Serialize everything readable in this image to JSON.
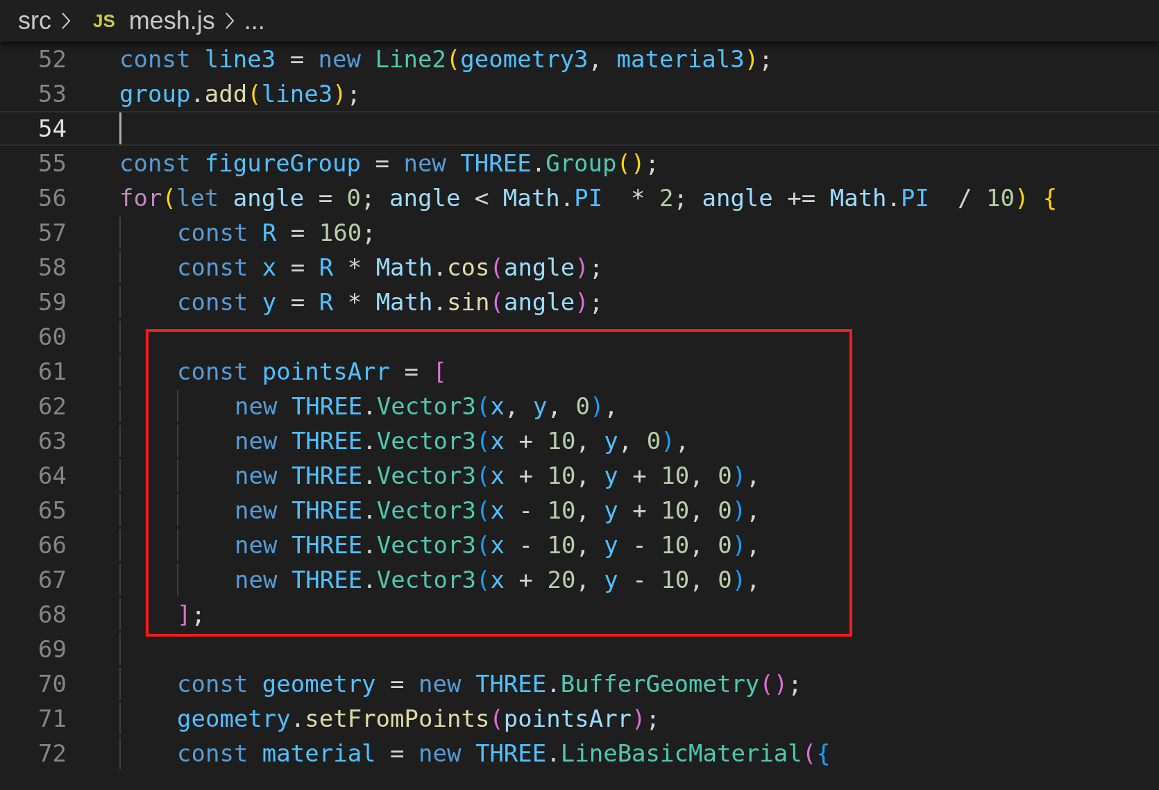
{
  "breadcrumbs": {
    "folder": "src",
    "file_badge": "JS",
    "file": "mesh.js",
    "tail": "..."
  },
  "lines": [
    {
      "kind": "line",
      "number": "52",
      "current": false,
      "tokens": [
        {
          "kind": "keyword",
          "text": "const "
        },
        {
          "kind": "constant",
          "text": "line3"
        },
        {
          "kind": "punct",
          "text": " = "
        },
        {
          "kind": "keyword",
          "text": "new "
        },
        {
          "kind": "class",
          "text": "Line2"
        },
        {
          "kind": "bracket1",
          "text": "("
        },
        {
          "kind": "constant",
          "text": "geometry3"
        },
        {
          "kind": "punct",
          "text": ", "
        },
        {
          "kind": "constant",
          "text": "material3"
        },
        {
          "kind": "bracket1",
          "text": ")"
        },
        {
          "kind": "punct",
          "text": ";"
        }
      ]
    },
    {
      "kind": "line",
      "number": "53",
      "current": false,
      "tokens": [
        {
          "kind": "constant",
          "text": "group"
        },
        {
          "kind": "punct",
          "text": "."
        },
        {
          "kind": "function",
          "text": "add"
        },
        {
          "kind": "bracket1",
          "text": "("
        },
        {
          "kind": "constant",
          "text": "line3"
        },
        {
          "kind": "bracket1",
          "text": ")"
        },
        {
          "kind": "punct",
          "text": ";"
        }
      ]
    },
    {
      "kind": "line",
      "number": "54",
      "current": true
    },
    {
      "kind": "line",
      "number": "55",
      "current": false,
      "tokens": [
        {
          "kind": "keyword",
          "text": "const "
        },
        {
          "kind": "constant",
          "text": "figureGroup"
        },
        {
          "kind": "punct",
          "text": " = "
        },
        {
          "kind": "keyword",
          "text": "new "
        },
        {
          "kind": "constant",
          "text": "THREE"
        },
        {
          "kind": "punct",
          "text": "."
        },
        {
          "kind": "class",
          "text": "Group"
        },
        {
          "kind": "bracket1",
          "text": "()"
        },
        {
          "kind": "punct",
          "text": ";"
        }
      ]
    },
    {
      "kind": "line",
      "number": "56",
      "current": false,
      "tokens": [
        {
          "kind": "control",
          "text": "for"
        },
        {
          "kind": "bracket1",
          "text": "("
        },
        {
          "kind": "keyword",
          "text": "let "
        },
        {
          "kind": "variable",
          "text": "angle"
        },
        {
          "kind": "punct",
          "text": " = "
        },
        {
          "kind": "number",
          "text": "0"
        },
        {
          "kind": "punct",
          "text": "; "
        },
        {
          "kind": "variable",
          "text": "angle"
        },
        {
          "kind": "punct",
          "text": " < "
        },
        {
          "kind": "variable",
          "text": "Math"
        },
        {
          "kind": "punct",
          "text": "."
        },
        {
          "kind": "constant",
          "text": "PI"
        },
        {
          "kind": "punct",
          "text": "  * "
        },
        {
          "kind": "number",
          "text": "2"
        },
        {
          "kind": "punct",
          "text": "; "
        },
        {
          "kind": "variable",
          "text": "angle"
        },
        {
          "kind": "punct",
          "text": " += "
        },
        {
          "kind": "variable",
          "text": "Math"
        },
        {
          "kind": "punct",
          "text": "."
        },
        {
          "kind": "constant",
          "text": "PI"
        },
        {
          "kind": "punct",
          "text": "  / "
        },
        {
          "kind": "number",
          "text": "10"
        },
        {
          "kind": "bracket1",
          "text": ") {"
        }
      ],
      "children": [
        {
          "kind": "line",
          "number": "57",
          "current": false,
          "tokens": [
            {
              "kind": "keyword",
              "text": "const "
            },
            {
              "kind": "constant",
              "text": "R"
            },
            {
              "kind": "punct",
              "text": " = "
            },
            {
              "kind": "number",
              "text": "160"
            },
            {
              "kind": "punct",
              "text": ";"
            }
          ]
        },
        {
          "kind": "line",
          "number": "58",
          "current": false,
          "tokens": [
            {
              "kind": "keyword",
              "text": "const "
            },
            {
              "kind": "constant",
              "text": "x"
            },
            {
              "kind": "punct",
              "text": " = "
            },
            {
              "kind": "constant",
              "text": "R"
            },
            {
              "kind": "punct",
              "text": " * "
            },
            {
              "kind": "variable",
              "text": "Math"
            },
            {
              "kind": "punct",
              "text": "."
            },
            {
              "kind": "function",
              "text": "cos"
            },
            {
              "kind": "bracket2",
              "text": "("
            },
            {
              "kind": "variable",
              "text": "angle"
            },
            {
              "kind": "bracket2",
              "text": ")"
            },
            {
              "kind": "punct",
              "text": ";"
            }
          ]
        },
        {
          "kind": "line",
          "number": "59",
          "current": false,
          "tokens": [
            {
              "kind": "keyword",
              "text": "const "
            },
            {
              "kind": "constant",
              "text": "y"
            },
            {
              "kind": "punct",
              "text": " = "
            },
            {
              "kind": "constant",
              "text": "R"
            },
            {
              "kind": "punct",
              "text": " * "
            },
            {
              "kind": "variable",
              "text": "Math"
            },
            {
              "kind": "punct",
              "text": "."
            },
            {
              "kind": "function",
              "text": "sin"
            },
            {
              "kind": "bracket2",
              "text": "("
            },
            {
              "kind": "variable",
              "text": "angle"
            },
            {
              "kind": "bracket2",
              "text": ")"
            },
            {
              "kind": "punct",
              "text": ";"
            }
          ]
        },
        {
          "kind": "boxed",
          "lines": [
            {
              "kind": "line",
              "number": "60",
              "current": false
            },
            {
              "kind": "line",
              "number": "61",
              "current": false,
              "tokens": [
                {
                  "kind": "keyword",
                  "text": "const "
                },
                {
                  "kind": "constant",
                  "text": "pointsArr"
                },
                {
                  "kind": "punct",
                  "text": " = "
                },
                {
                  "kind": "bracket2",
                  "text": "["
                }
              ],
              "children": [
                {
                  "kind": "line",
                  "number": "62",
                  "current": false,
                  "tokens": [
                    {
                      "kind": "keyword",
                      "text": "new "
                    },
                    {
                      "kind": "constant",
                      "text": "THREE"
                    },
                    {
                      "kind": "punct",
                      "text": "."
                    },
                    {
                      "kind": "class",
                      "text": "Vector3"
                    },
                    {
                      "kind": "bracket3",
                      "text": "("
                    },
                    {
                      "kind": "constant",
                      "text": "x"
                    },
                    {
                      "kind": "punct",
                      "text": ", "
                    },
                    {
                      "kind": "constant",
                      "text": "y"
                    },
                    {
                      "kind": "punct",
                      "text": ", "
                    },
                    {
                      "kind": "number",
                      "text": "0"
                    },
                    {
                      "kind": "bracket3",
                      "text": ")"
                    },
                    {
                      "kind": "punct",
                      "text": ","
                    }
                  ]
                },
                {
                  "kind": "line",
                  "number": "63",
                  "current": false,
                  "tokens": [
                    {
                      "kind": "keyword",
                      "text": "new "
                    },
                    {
                      "kind": "constant",
                      "text": "THREE"
                    },
                    {
                      "kind": "punct",
                      "text": "."
                    },
                    {
                      "kind": "class",
                      "text": "Vector3"
                    },
                    {
                      "kind": "bracket3",
                      "text": "("
                    },
                    {
                      "kind": "constant",
                      "text": "x"
                    },
                    {
                      "kind": "punct",
                      "text": " + "
                    },
                    {
                      "kind": "number",
                      "text": "10"
                    },
                    {
                      "kind": "punct",
                      "text": ", "
                    },
                    {
                      "kind": "constant",
                      "text": "y"
                    },
                    {
                      "kind": "punct",
                      "text": ", "
                    },
                    {
                      "kind": "number",
                      "text": "0"
                    },
                    {
                      "kind": "bracket3",
                      "text": ")"
                    },
                    {
                      "kind": "punct",
                      "text": ","
                    }
                  ]
                },
                {
                  "kind": "line",
                  "number": "64",
                  "current": false,
                  "tokens": [
                    {
                      "kind": "keyword",
                      "text": "new "
                    },
                    {
                      "kind": "constant",
                      "text": "THREE"
                    },
                    {
                      "kind": "punct",
                      "text": "."
                    },
                    {
                      "kind": "class",
                      "text": "Vector3"
                    },
                    {
                      "kind": "bracket3",
                      "text": "("
                    },
                    {
                      "kind": "constant",
                      "text": "x"
                    },
                    {
                      "kind": "punct",
                      "text": " + "
                    },
                    {
                      "kind": "number",
                      "text": "10"
                    },
                    {
                      "kind": "punct",
                      "text": ", "
                    },
                    {
                      "kind": "constant",
                      "text": "y"
                    },
                    {
                      "kind": "punct",
                      "text": " + "
                    },
                    {
                      "kind": "number",
                      "text": "10"
                    },
                    {
                      "kind": "punct",
                      "text": ", "
                    },
                    {
                      "kind": "number",
                      "text": "0"
                    },
                    {
                      "kind": "bracket3",
                      "text": ")"
                    },
                    {
                      "kind": "punct",
                      "text": ","
                    }
                  ]
                },
                {
                  "kind": "line",
                  "number": "65",
                  "current": false,
                  "tokens": [
                    {
                      "kind": "keyword",
                      "text": "new "
                    },
                    {
                      "kind": "constant",
                      "text": "THREE"
                    },
                    {
                      "kind": "punct",
                      "text": "."
                    },
                    {
                      "kind": "class",
                      "text": "Vector3"
                    },
                    {
                      "kind": "bracket3",
                      "text": "("
                    },
                    {
                      "kind": "constant",
                      "text": "x"
                    },
                    {
                      "kind": "punct",
                      "text": " - "
                    },
                    {
                      "kind": "number",
                      "text": "10"
                    },
                    {
                      "kind": "punct",
                      "text": ", "
                    },
                    {
                      "kind": "constant",
                      "text": "y"
                    },
                    {
                      "kind": "punct",
                      "text": " + "
                    },
                    {
                      "kind": "number",
                      "text": "10"
                    },
                    {
                      "kind": "punct",
                      "text": ", "
                    },
                    {
                      "kind": "number",
                      "text": "0"
                    },
                    {
                      "kind": "bracket3",
                      "text": ")"
                    },
                    {
                      "kind": "punct",
                      "text": ","
                    }
                  ]
                },
                {
                  "kind": "line",
                  "number": "66",
                  "current": false,
                  "tokens": [
                    {
                      "kind": "keyword",
                      "text": "new "
                    },
                    {
                      "kind": "constant",
                      "text": "THREE"
                    },
                    {
                      "kind": "punct",
                      "text": "."
                    },
                    {
                      "kind": "class",
                      "text": "Vector3"
                    },
                    {
                      "kind": "bracket3",
                      "text": "("
                    },
                    {
                      "kind": "constant",
                      "text": "x"
                    },
                    {
                      "kind": "punct",
                      "text": " - "
                    },
                    {
                      "kind": "number",
                      "text": "10"
                    },
                    {
                      "kind": "punct",
                      "text": ", "
                    },
                    {
                      "kind": "constant",
                      "text": "y"
                    },
                    {
                      "kind": "punct",
                      "text": " - "
                    },
                    {
                      "kind": "number",
                      "text": "10"
                    },
                    {
                      "kind": "punct",
                      "text": ", "
                    },
                    {
                      "kind": "number",
                      "text": "0"
                    },
                    {
                      "kind": "bracket3",
                      "text": ")"
                    },
                    {
                      "kind": "punct",
                      "text": ","
                    }
                  ]
                },
                {
                  "kind": "line",
                  "number": "67",
                  "current": false,
                  "tokens": [
                    {
                      "kind": "keyword",
                      "text": "new "
                    },
                    {
                      "kind": "constant",
                      "text": "THREE"
                    },
                    {
                      "kind": "punct",
                      "text": "."
                    },
                    {
                      "kind": "class",
                      "text": "Vector3"
                    },
                    {
                      "kind": "bracket3",
                      "text": "("
                    },
                    {
                      "kind": "constant",
                      "text": "x"
                    },
                    {
                      "kind": "punct",
                      "text": " + "
                    },
                    {
                      "kind": "number",
                      "text": "20"
                    },
                    {
                      "kind": "punct",
                      "text": ", "
                    },
                    {
                      "kind": "constant",
                      "text": "y"
                    },
                    {
                      "kind": "punct",
                      "text": " - "
                    },
                    {
                      "kind": "number",
                      "text": "10"
                    },
                    {
                      "kind": "punct",
                      "text": ", "
                    },
                    {
                      "kind": "number",
                      "text": "0"
                    },
                    {
                      "kind": "bracket3",
                      "text": ")"
                    },
                    {
                      "kind": "punct",
                      "text": ","
                    }
                  ]
                }
              ]
            },
            {
              "kind": "line",
              "number": "68",
              "current": false,
              "tokens": [
                {
                  "kind": "bracket2",
                  "text": "]"
                },
                {
                  "kind": "punct",
                  "text": ";"
                }
              ]
            }
          ]
        },
        {
          "kind": "line",
          "number": "69",
          "current": false
        },
        {
          "kind": "line",
          "number": "70",
          "current": false,
          "tokens": [
            {
              "kind": "keyword",
              "text": "const "
            },
            {
              "kind": "constant",
              "text": "geometry"
            },
            {
              "kind": "punct",
              "text": " = "
            },
            {
              "kind": "keyword",
              "text": "new "
            },
            {
              "kind": "constant",
              "text": "THREE"
            },
            {
              "kind": "punct",
              "text": "."
            },
            {
              "kind": "class",
              "text": "BufferGeometry"
            },
            {
              "kind": "bracket2",
              "text": "()"
            },
            {
              "kind": "punct",
              "text": ";"
            }
          ]
        },
        {
          "kind": "line",
          "number": "71",
          "current": false,
          "tokens": [
            {
              "kind": "constant",
              "text": "geometry"
            },
            {
              "kind": "punct",
              "text": "."
            },
            {
              "kind": "function",
              "text": "setFromPoints"
            },
            {
              "kind": "bracket2",
              "text": "("
            },
            {
              "kind": "variable",
              "text": "pointsArr"
            },
            {
              "kind": "bracket2",
              "text": ")"
            },
            {
              "kind": "punct",
              "text": ";"
            }
          ]
        },
        {
          "kind": "line",
          "number": "72",
          "current": false,
          "tokens": [
            {
              "kind": "keyword",
              "text": "const "
            },
            {
              "kind": "constant",
              "text": "material"
            },
            {
              "kind": "punct",
              "text": " = "
            },
            {
              "kind": "keyword",
              "text": "new "
            },
            {
              "kind": "constant",
              "text": "THREE"
            },
            {
              "kind": "punct",
              "text": "."
            },
            {
              "kind": "class",
              "text": "LineBasicMaterial"
            },
            {
              "kind": "bracket2",
              "text": "("
            },
            {
              "kind": "bracket3",
              "text": "{"
            }
          ]
        }
      ]
    }
  ]
}
